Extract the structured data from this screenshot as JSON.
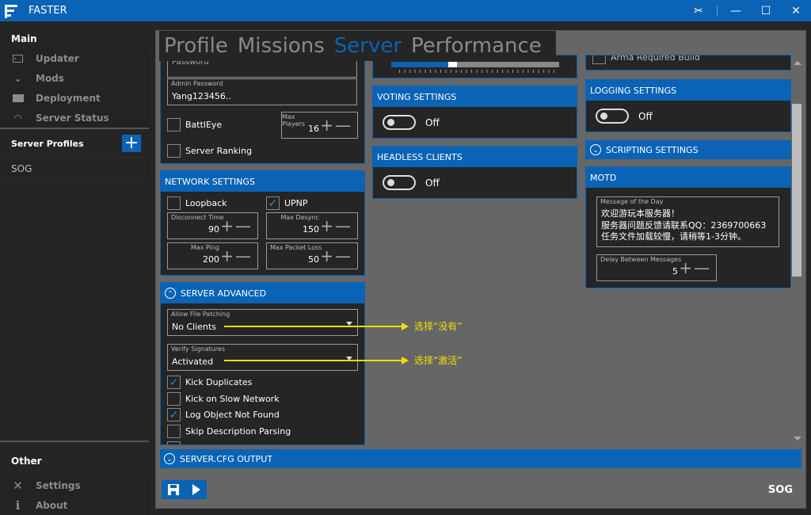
{
  "window": {
    "title": "FASTER",
    "controls": {
      "tools_icon": "wrench-screwdriver-icon",
      "minimize": "—",
      "maximize": "☐",
      "close": "✕"
    }
  },
  "sidebar": {
    "main_heading": "Main",
    "main_items": [
      {
        "label": "Updater",
        "icon": "console-icon"
      },
      {
        "label": "Mods",
        "icon": "steam-icon"
      },
      {
        "label": "Deployment",
        "icon": "briefcase-icon"
      },
      {
        "label": "Server Status",
        "icon": "gauge-icon"
      }
    ],
    "profiles_heading": "Server Profiles",
    "add_profile": "+",
    "profiles": [
      "SOG"
    ],
    "other_heading": "Other",
    "other_items": [
      {
        "label": "Settings",
        "icon": "tools-icon"
      },
      {
        "label": "About",
        "icon": "info-icon"
      }
    ]
  },
  "tabs": [
    {
      "label": "Profile",
      "active": false
    },
    {
      "label": "Missions",
      "active": false
    },
    {
      "label": "Server",
      "active": true
    },
    {
      "label": "Performance",
      "active": false
    }
  ],
  "server": {
    "password_label": "Password",
    "admin_password_label": "Admin Password",
    "admin_password_value": "Yang123456..",
    "battleye_label": "BattlEye",
    "battleye_checked": false,
    "server_ranking_label": "Server Ranking",
    "server_ranking_checked": false,
    "max_players_label": "Max Players",
    "max_players_value": "16",
    "plus": "+",
    "minus": "—",
    "slider_fraction": 0.34
  },
  "network": {
    "title": "NETWORK SETTINGS",
    "loopback_label": "Loopback",
    "loopback_checked": false,
    "upnp_label": "UPNP",
    "upnp_checked": true,
    "disconnect_label": "Disconnect Time",
    "disconnect_value": "90",
    "max_desync_label": "Max Desync",
    "max_desync_value": "150",
    "max_ping_label": "Max Ping",
    "max_ping_value": "200",
    "max_packet_label": "Max Packet Loss",
    "max_packet_value": "50"
  },
  "advanced": {
    "title": "SERVER ADVANCED",
    "file_patching_label": "Allow File Patching",
    "file_patching_value": "No Clients",
    "verify_sig_label": "Verify Signatures",
    "verify_sig_value": "Activated",
    "checks": [
      {
        "label": "Kick Duplicates",
        "checked": true
      },
      {
        "label": "Kick on Slow Network",
        "checked": false
      },
      {
        "label": "Log Object Not Found",
        "checked": true
      },
      {
        "label": "Skip Description Parsing",
        "checked": false
      }
    ]
  },
  "annotations": {
    "note1": "选择“没有”",
    "note2": "选择“激活”",
    "color": "#f0e000"
  },
  "voting": {
    "title": "VOTING SETTINGS",
    "state": "Off"
  },
  "headless": {
    "title": "HEADLESS CLIENTS",
    "state": "Off"
  },
  "right": {
    "arma_required_label": "Arma Required Build",
    "logging_title": "LOGGING SETTINGS",
    "logging_state": "Off",
    "scripting_title": "SCRIPTING SETTINGS",
    "motd_title": "MOTD",
    "motd_label": "Message of the Day",
    "motd_lines": "欢迎游玩本服务器！\n服务器问题反馈请联系QQ：2369700663\n任务文件加载较慢，请稍等1-3分钟。",
    "delay_label": "Delay Between Messages",
    "delay_value": "5"
  },
  "bottom": {
    "cfg_output_title": "SERVER.CFG OUTPUT",
    "save_icon": "save-icon",
    "launch_icon": "play-icon",
    "profile_name": "SOG"
  },
  "colors": {
    "accent": "#0a63b5",
    "background": "#252525",
    "panel_area": "#666666"
  }
}
